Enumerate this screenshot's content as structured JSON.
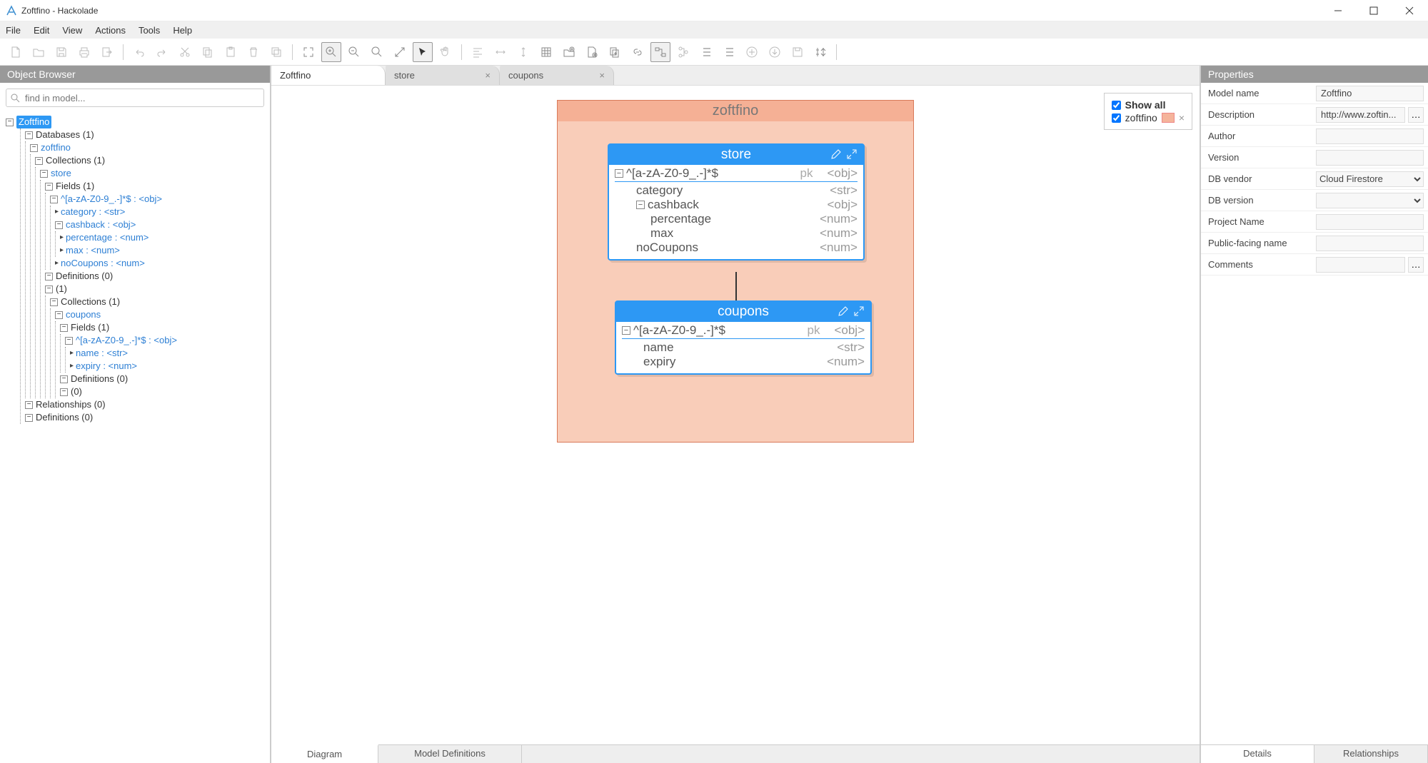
{
  "window": {
    "title": "Zoftfino - Hackolade"
  },
  "menu": [
    "File",
    "Edit",
    "View",
    "Actions",
    "Tools",
    "Help"
  ],
  "objectBrowser": {
    "title": "Object Browser",
    "searchPlaceholder": "find in model...",
    "root": "Zoftfino",
    "databasesLabel": "Databases (1)",
    "db": "zoftfino",
    "collections1": "Collections (1)",
    "store": "store",
    "fields1": "Fields (1)",
    "pattern1": "^[a-zA-Z0-9_.-]*$ : <obj>",
    "category": "category : <str>",
    "cashback": "cashback : <obj>",
    "percentage": "percentage : <num>",
    "max": "max : <num>",
    "noCoupons": "noCoupons : <num>",
    "defs0a": "Definitions (0)",
    "anon1": "(1)",
    "collections1b": "Collections (1)",
    "coupons": "coupons",
    "fields1b": "Fields (1)",
    "pattern2": "^[a-zA-Z0-9_.-]*$ : <obj>",
    "name": "name : <str>",
    "expiry": "expiry : <num>",
    "defs0b": "Definitions (0)",
    "zero": "(0)",
    "relationships": "Relationships (0)",
    "definitions": "Definitions (0)"
  },
  "tabs": [
    {
      "label": "Zoftfino",
      "active": true,
      "closable": false
    },
    {
      "label": "store",
      "active": false,
      "closable": true
    },
    {
      "label": "coupons",
      "active": false,
      "closable": true
    }
  ],
  "legend": {
    "showAll": "Show all",
    "items": [
      {
        "label": "zoftfino"
      }
    ]
  },
  "diagram": {
    "container": "zoftfino",
    "store": {
      "title": "store",
      "rows": [
        {
          "tog": "−",
          "name": "^[a-zA-Z0-9_.-]*$",
          "pk": "pk",
          "type": "<obj>",
          "indent": 0,
          "line": true
        },
        {
          "name": "category",
          "type": "<str>",
          "indent": 1
        },
        {
          "tog": "−",
          "name": "cashback",
          "type": "<obj>",
          "indent": 1
        },
        {
          "name": "percentage",
          "type": "<num>",
          "indent": 2
        },
        {
          "name": "max",
          "type": "<num>",
          "indent": 2
        },
        {
          "name": "noCoupons",
          "type": "<num>",
          "indent": 1
        }
      ]
    },
    "coupons": {
      "title": "coupons",
      "rows": [
        {
          "tog": "−",
          "name": "^[a-zA-Z0-9_.-]*$",
          "pk": "pk",
          "type": "<obj>",
          "indent": 0,
          "line": true
        },
        {
          "name": "name",
          "type": "<str>",
          "indent": 1
        },
        {
          "name": "expiry",
          "type": "<num>",
          "indent": 1
        }
      ]
    }
  },
  "bottomTabs": {
    "diagram": "Diagram",
    "modelDefs": "Model Definitions"
  },
  "properties": {
    "title": "Properties",
    "rows": [
      {
        "label": "Model name",
        "value": "Zoftfino",
        "type": "text"
      },
      {
        "label": "Description",
        "value": "http://www.zoftin...",
        "type": "desc"
      },
      {
        "label": "Author",
        "value": "",
        "type": "text"
      },
      {
        "label": "Version",
        "value": "",
        "type": "text"
      },
      {
        "label": "DB vendor",
        "value": "Cloud Firestore",
        "type": "select"
      },
      {
        "label": "DB version",
        "value": "",
        "type": "select"
      },
      {
        "label": "Project Name",
        "value": "",
        "type": "text"
      },
      {
        "label": "Public-facing name",
        "value": "",
        "type": "text"
      },
      {
        "label": "Comments",
        "value": "",
        "type": "desc"
      }
    ],
    "tabs": {
      "details": "Details",
      "relationships": "Relationships"
    }
  }
}
